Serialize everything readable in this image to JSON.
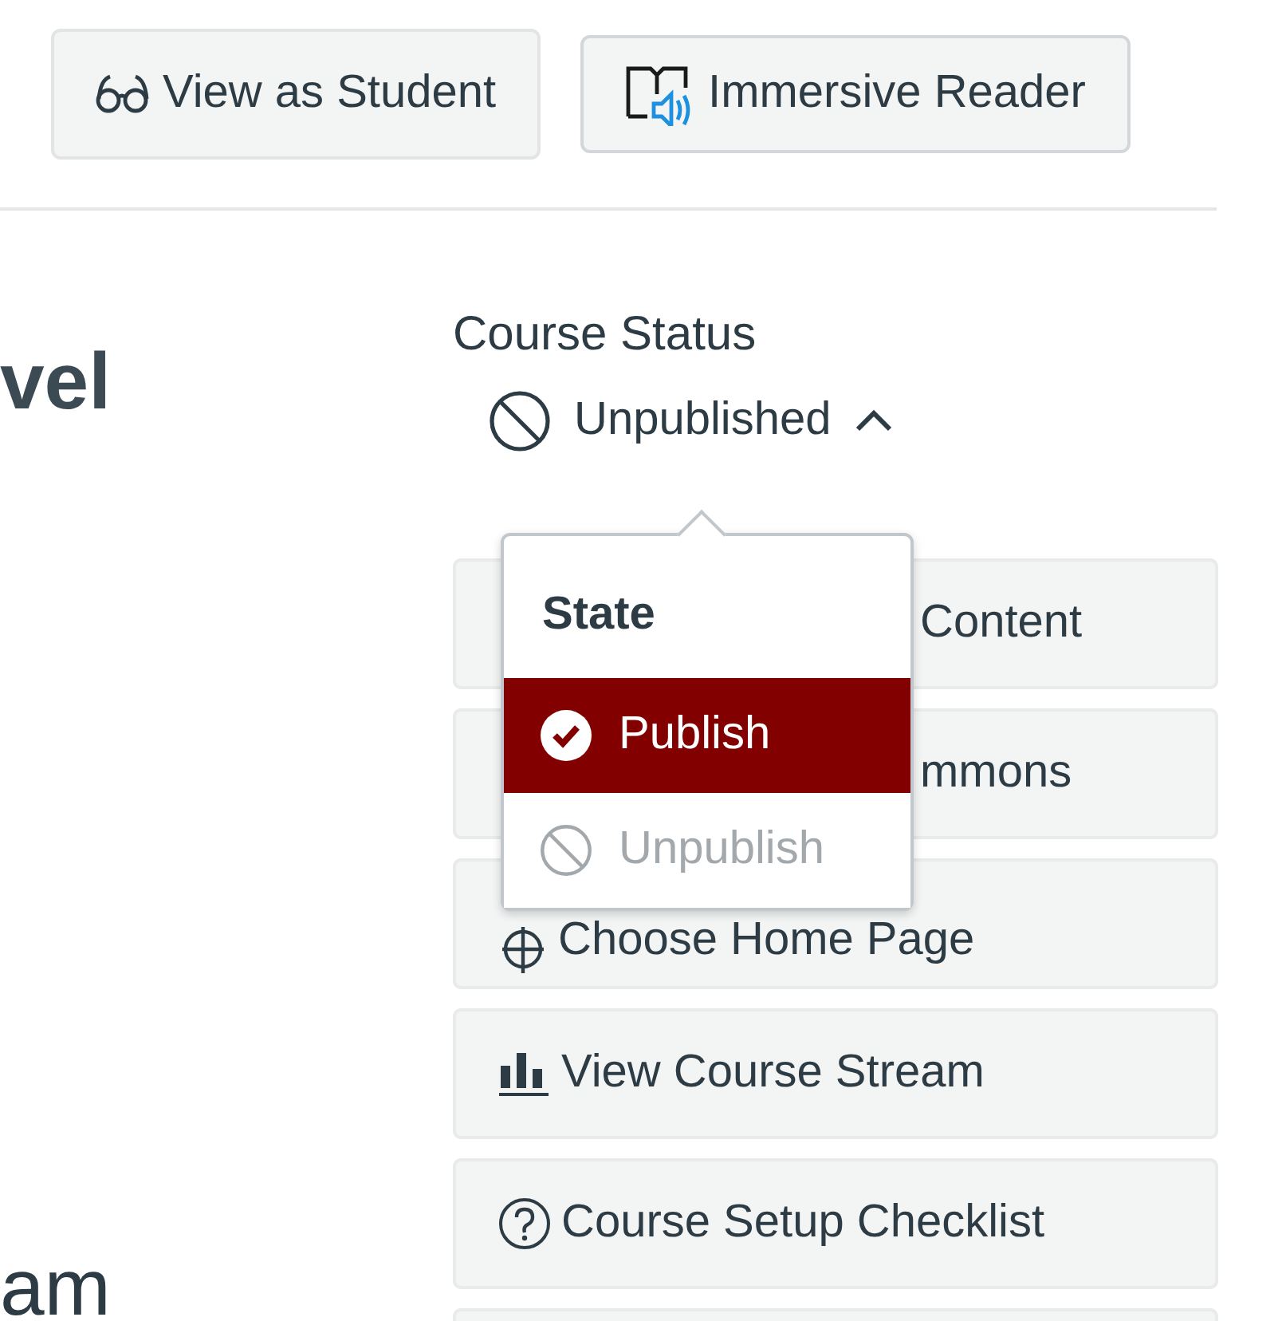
{
  "header_buttons": [
    {
      "label": "View as Student",
      "kind": "glasses"
    },
    {
      "label": "Immersive Reader",
      "kind": "reader"
    }
  ],
  "left_fragments": [
    {
      "text": "vel",
      "kind": "heading"
    },
    {
      "text": "am",
      "kind": "body"
    }
  ],
  "course_status": {
    "heading": "Course Status",
    "status": "Unpublished",
    "expanded": true
  },
  "state_menu": {
    "title": "State",
    "items": [
      {
        "label": "Publish",
        "kind": "check",
        "selected": true,
        "disabled": false
      },
      {
        "label": "Unpublish",
        "kind": "ban",
        "selected": false,
        "disabled": true
      }
    ]
  },
  "sidebar_buttons": [
    {
      "label": "Content",
      "kind": "covered"
    },
    {
      "label": "mmons",
      "kind": "covered"
    },
    {
      "label": "Choose Home Page",
      "kind": "target"
    },
    {
      "label": "View Course Stream",
      "kind": "stream"
    },
    {
      "label": "Course Setup Checklist",
      "kind": "help"
    },
    {
      "kind": "blank"
    }
  ]
}
